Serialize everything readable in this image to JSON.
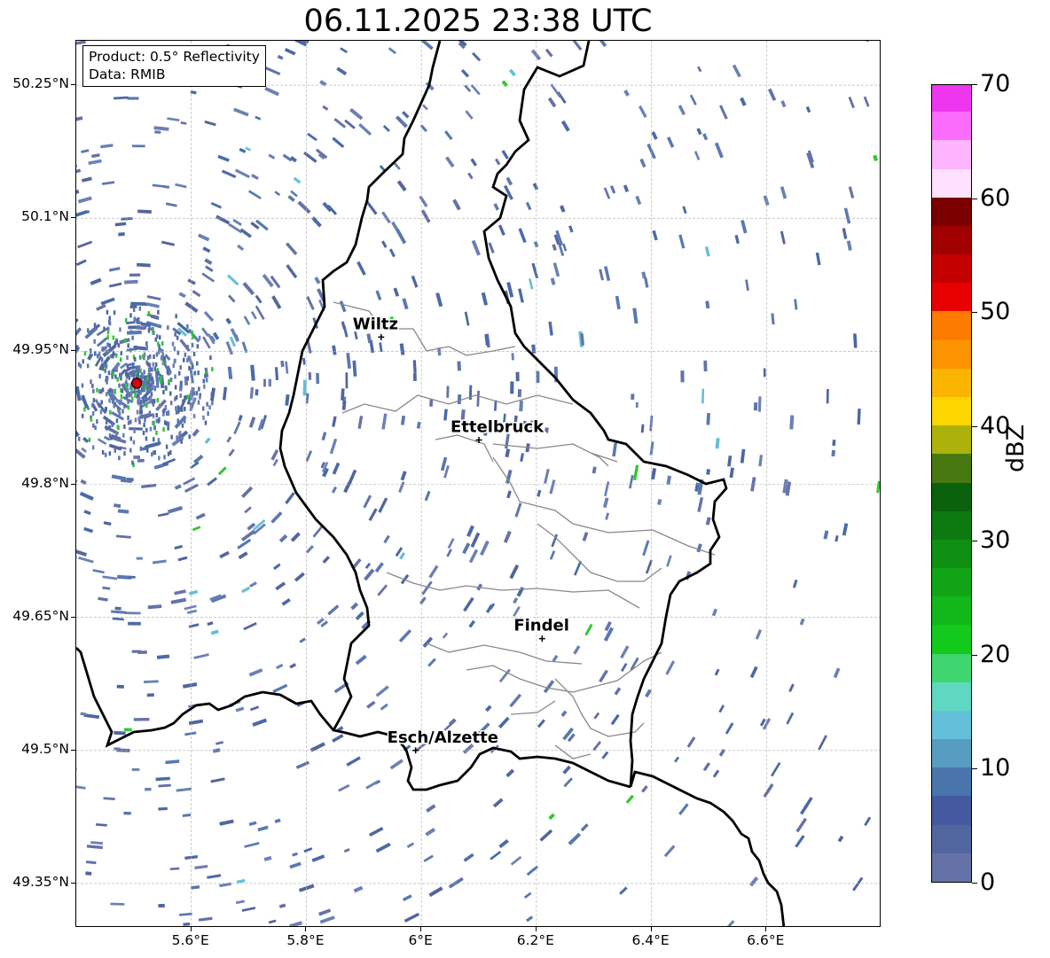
{
  "title": "06.11.2025 23:38 UTC",
  "info": {
    "product": "Product: 0.5° Reflectivity",
    "data": "Data: RMIB"
  },
  "axes": {
    "y_ticks": [
      "50.25°N",
      "50.1°N",
      "49.95°N",
      "49.8°N",
      "49.65°N",
      "49.5°N",
      "49.35°N"
    ],
    "x_ticks": [
      "5.6°E",
      "5.8°E",
      "6°E",
      "6.2°E",
      "6.4°E",
      "6.6°E"
    ],
    "lon_range": [
      5.4,
      6.8
    ],
    "lat_range": [
      49.3,
      50.3
    ],
    "grid": true
  },
  "colorbar": {
    "label": "dBZ",
    "ticks": [
      "0",
      "10",
      "20",
      "30",
      "40",
      "50",
      "60",
      "70"
    ],
    "range": [
      0,
      70
    ],
    "step": 2.5,
    "colors": [
      "#6472a8",
      "#51669e",
      "#44599f",
      "#4a74ac",
      "#579dc2",
      "#64c0d8",
      "#5fd8c2",
      "#3fd670",
      "#12c91c",
      "#12b81a",
      "#11a516",
      "#0e8f12",
      "#0c7a10",
      "#0a620c",
      "#467a10",
      "#adb20a",
      "#fdd600",
      "#fbb400",
      "#fb9400",
      "#fd7c00",
      "#e80000",
      "#c40000",
      "#a00000",
      "#7a0000",
      "#ffe0ff",
      "#ffb4ff",
      "#fc6cfc",
      "#ee36ee"
    ]
  },
  "cities": [
    {
      "name": "Wiltz",
      "lon": 5.93,
      "lat": 49.966
    },
    {
      "name": "Ettelbruck",
      "lon": 6.1,
      "lat": 49.85
    },
    {
      "name": "Findel",
      "lon": 6.21,
      "lat": 49.626
    },
    {
      "name": "Esch/Alzette",
      "lon": 5.99,
      "lat": 49.5
    }
  ],
  "radar_site": {
    "lon": 5.505,
    "lat": 49.914
  }
}
